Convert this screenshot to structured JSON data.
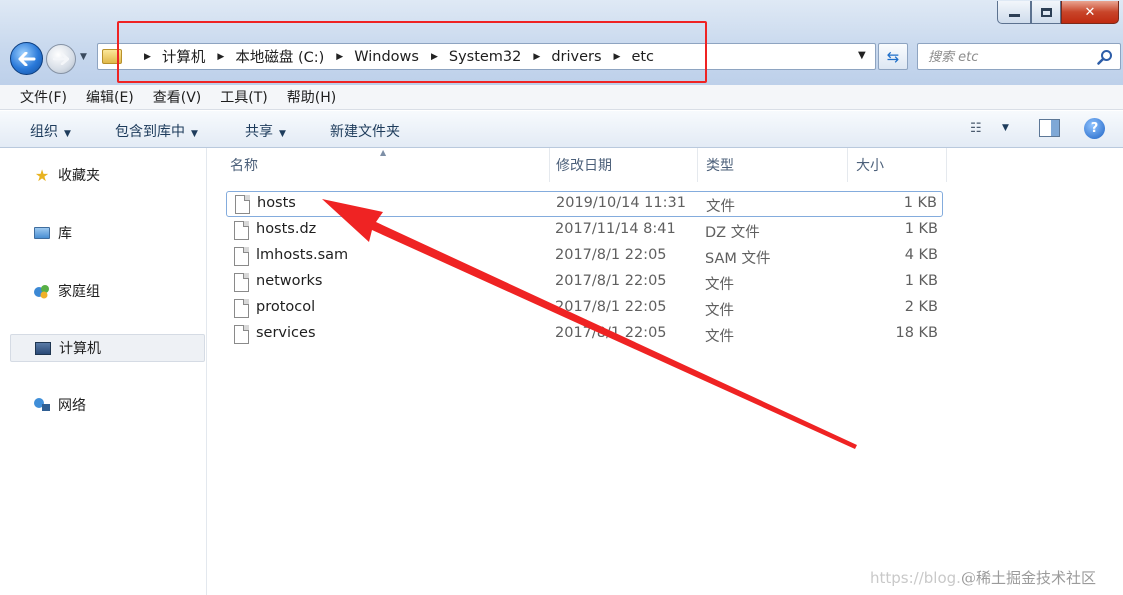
{
  "window": {
    "minimize_label": "–",
    "maximize_label": "▫",
    "close_label": "✕"
  },
  "breadcrumbs": [
    "计算机",
    "本地磁盘 (C:)",
    "Windows",
    "System32",
    "drivers",
    "etc"
  ],
  "search": {
    "placeholder": "搜索 etc"
  },
  "menu": [
    "文件(F)",
    "编辑(E)",
    "查看(V)",
    "工具(T)",
    "帮助(H)"
  ],
  "toolbar": {
    "organize": "组织",
    "include_in_library": "包含到库中",
    "share": "共享",
    "new_folder": "新建文件夹"
  },
  "sidebar": [
    {
      "label": "收藏夹",
      "icon": "star-icon"
    },
    {
      "label": "库",
      "icon": "library-icon"
    },
    {
      "label": "家庭组",
      "icon": "homegroup-icon"
    },
    {
      "label": "计算机",
      "icon": "computer-icon"
    },
    {
      "label": "网络",
      "icon": "network-icon"
    }
  ],
  "columns": {
    "name": "名称",
    "date": "修改日期",
    "type": "类型",
    "size": "大小"
  },
  "files": [
    {
      "name": "hosts",
      "date": "2019/10/14 11:31",
      "type": "文件",
      "size": "1 KB"
    },
    {
      "name": "hosts.dz",
      "date": "2017/11/14 8:41",
      "type": "DZ 文件",
      "size": "1 KB"
    },
    {
      "name": "lmhosts.sam",
      "date": "2017/8/1 22:05",
      "type": "SAM 文件",
      "size": "4 KB"
    },
    {
      "name": "networks",
      "date": "2017/8/1 22:05",
      "type": "文件",
      "size": "1 KB"
    },
    {
      "name": "protocol",
      "date": "2017/8/1 22:05",
      "type": "文件",
      "size": "2 KB"
    },
    {
      "name": "services",
      "date": "2017/8/1 22:05",
      "type": "文件",
      "size": "18 KB"
    }
  ],
  "selected_file": "hosts",
  "annotation_color": "#ef2323",
  "watermark": {
    "url": "https://blog.",
    "brand": "@稀土掘金技术社区"
  }
}
